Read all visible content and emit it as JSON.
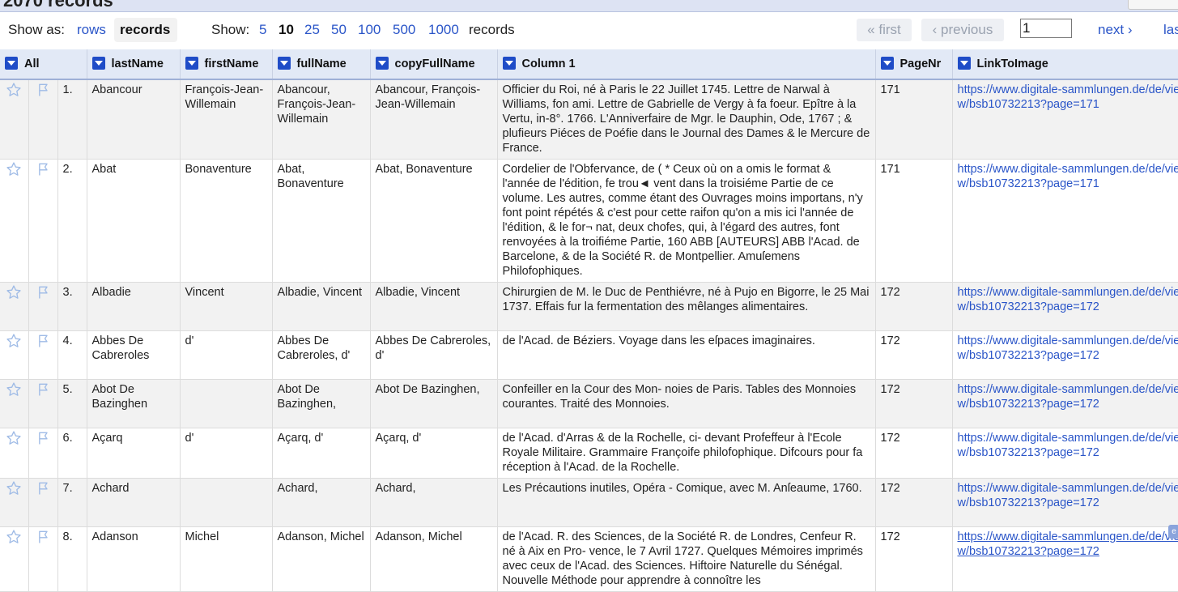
{
  "summary": {
    "record_count": "2070 records"
  },
  "controls": {
    "show_as_label": "Show as:",
    "rows_link": "rows",
    "records_current": "records",
    "show_label": "Show:",
    "page_sizes": [
      "5",
      "10",
      "25",
      "50",
      "100",
      "500",
      "1000"
    ],
    "current_page_size": "10",
    "records_suffix": "records",
    "first_label": "« first",
    "previous_label": "‹ previous",
    "page_input_value": "1",
    "next_label": "next ›",
    "last_label": "last »"
  },
  "columns": [
    {
      "label": "All"
    },
    {
      "label": "lastName"
    },
    {
      "label": "firstName"
    },
    {
      "label": "fullName"
    },
    {
      "label": "copyFullName"
    },
    {
      "label": "Column 1"
    },
    {
      "label": "PageNr"
    },
    {
      "label": "LinkToImage"
    }
  ],
  "icons": {
    "star": "star-outline-icon",
    "flag": "flag-outline-icon",
    "dropdown": "dropdown-arrow-icon"
  },
  "colors": {
    "link": "#2a55c8",
    "header_bg": "#e2e9f6",
    "dropdown_btn": "#1f4cc7",
    "odd_row": "#f2f2f2"
  },
  "rows": [
    {
      "num": "1.",
      "lastName": "Abancour",
      "firstName": "François-Jean-Willemain",
      "fullName": "Abancour, François-Jean-Willemain",
      "copyFullName": "Abancour, François-Jean-Willemain",
      "column1": "Officier du Roi, né à Paris le 22 Juillet 1745. Lettre de Narwal à Williams, fon ami. Lettre de Gabrielle de Vergy à fa foeur. Epître à la Vertu, in-8°. 1766. L'Anniverfaire de Mgr. le Dauphin, Ode, 1767 ; & plufieurs Piéces de Poéfie dans le Journal des Dames & le Mercure de France.",
      "pageNr": "171",
      "link": "https://www.digitale-sammlungen.de/de/view/bsb10732213?page=171"
    },
    {
      "num": "2.",
      "lastName": "Abat",
      "firstName": "Bonaventure",
      "fullName": "Abat, Bonaventure",
      "copyFullName": "Abat, Bonaventure",
      "column1": " Cordelier de l'Obfervance, de ( * Ceux où on a omis le format & l'année de l'édition, fe trou◄ vent dans la troisiéme Partie de ce volume. Les autres, comme étant des Ouvrages moins importans, n'y font point répétés & c'est pour cette raifon qu'on a mis ici l'année de l'édition, & le for¬ nat, deux chofes, qui, à l'égard des autres, font renvoyées à la troifiéme Partie, 160 ABB [AUTEURS] ABB l'Acad. de Barcelone, & de la Société R. de Montpellier. Amuſemens Philofophiques.",
      "pageNr": "171",
      "link": "https://www.digitale-sammlungen.de/de/view/bsb10732213?page=171"
    },
    {
      "num": "3.",
      "lastName": "Albadie",
      "firstName": "Vincent",
      "fullName": "Albadie, Vincent",
      "copyFullName": "Albadie, Vincent",
      "column1": " Chirurgien de M. le Duc de Penthiévre, né à Pujo en Bigorre, le 25 Mai 1737. Effais fur la fermentation des mêlanges alimentaires.",
      "pageNr": "172",
      "link": "https://www.digitale-sammlungen.de/de/view/bsb10732213?page=172"
    },
    {
      "num": "4.",
      "lastName": "Abbes De Cabreroles",
      "firstName": "d'",
      "fullName": "Abbes De Cabreroles, d'",
      "copyFullName": "Abbes De Cabreroles, d'",
      "column1": " de l'Acad. de Béziers. Voyage dans les eſpaces imaginaires.",
      "pageNr": "172",
      "link": "https://www.digitale-sammlungen.de/de/view/bsb10732213?page=172"
    },
    {
      "num": "5.",
      "lastName": "Abot De Bazinghen",
      "firstName": "",
      "fullName": "Abot De Bazinghen,",
      "copyFullName": "Abot De Bazinghen,",
      "column1": " Confeiller en la Cour des Mon- noies de Paris. Tables des Monnoies courantes. Traité des Monnoies.",
      "pageNr": "172",
      "link": "https://www.digitale-sammlungen.de/de/view/bsb10732213?page=172"
    },
    {
      "num": "6.",
      "lastName": "Açarq",
      "firstName": "d'",
      "fullName": "Açarq, d'",
      "copyFullName": "Açarq, d'",
      "column1": " de l'Acad. d'Arras & de la Rochelle, ci- devant Profeffeur à l'Ecole Royale Militaire. Grammaire Françoife philofophique. Difcours pour fa réception à l'Acad. de la Rochelle.",
      "pageNr": "172",
      "link": "https://www.digitale-sammlungen.de/de/view/bsb10732213?page=172"
    },
    {
      "num": "7.",
      "lastName": "Achard",
      "firstName": "",
      "fullName": "Achard,",
      "copyFullName": "Achard,",
      "column1": " Les Précautions inutiles, Opéra - Comique, avec M. Anſeaume, 1760.",
      "pageNr": "172",
      "link": "https://www.digitale-sammlungen.de/de/view/bsb10732213?page=172"
    },
    {
      "num": "8.",
      "lastName": "Adanson",
      "firstName": "Michel",
      "fullName": "Adanson, Michel",
      "copyFullName": "Adanson, Michel",
      "column1": " de l'Acad. R. des Sciences, de la Société R. de Londres, Cenfeur R. né à Aix en Pro- vence, le 7 Avril 1727. Quelques Mémoires imprimés avec ceux de l'Acad. des Sciences. Hiftoire Naturelle du Sénégal. Nouvelle Méthode pour apprendre à connoître les",
      "pageNr": "172",
      "link": "https://www.digitale-sammlungen.de/de/view/bsb10732213?page=172"
    }
  ]
}
